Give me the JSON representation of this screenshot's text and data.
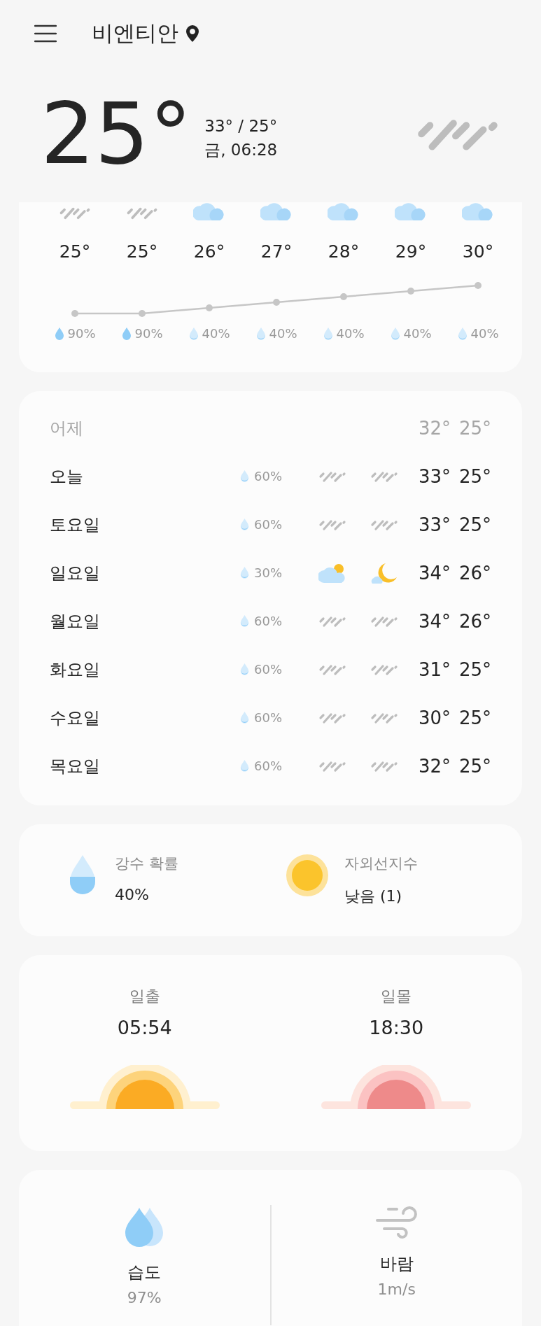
{
  "header": {
    "location": "비엔티안"
  },
  "current": {
    "temp": "25°",
    "high_low": "33° / 25°",
    "day_time": "금, 06:28",
    "icon": {
      "kind": "rain"
    }
  },
  "hourly": [
    {
      "kind": "rain",
      "temp": "25°",
      "drop": {
        "kind": "full"
      },
      "precip": "90%"
    },
    {
      "kind": "rain",
      "temp": "25°",
      "drop": {
        "kind": "full"
      },
      "precip": "90%"
    },
    {
      "kind": "cloudy",
      "temp": "26°",
      "drop": {
        "kind": "half"
      },
      "precip": "40%"
    },
    {
      "kind": "cloudy",
      "temp": "27°",
      "drop": {
        "kind": "half"
      },
      "precip": "40%"
    },
    {
      "kind": "cloudy",
      "temp": "28°",
      "drop": {
        "kind": "half"
      },
      "precip": "40%"
    },
    {
      "kind": "cloudy",
      "temp": "29°",
      "drop": {
        "kind": "half"
      },
      "precip": "40%"
    },
    {
      "kind": "cloudy",
      "temp": "30°",
      "drop": {
        "kind": "half"
      },
      "precip": "40%"
    }
  ],
  "yesterday": {
    "label": "어제",
    "high": "32°",
    "low": "25°"
  },
  "daily": [
    {
      "day": "오늘",
      "precip": "60%",
      "day_icon": {
        "kind": "rain"
      },
      "night_icon": {
        "kind": "rain"
      },
      "high": "33°",
      "low": "25°"
    },
    {
      "day": "토요일",
      "precip": "60%",
      "day_icon": {
        "kind": "rain"
      },
      "night_icon": {
        "kind": "rain"
      },
      "high": "33°",
      "low": "25°"
    },
    {
      "day": "일요일",
      "precip": "30%",
      "day_icon": {
        "kind": "partly-cloudy"
      },
      "night_icon": {
        "kind": "night-cloudy"
      },
      "high": "34°",
      "low": "26°"
    },
    {
      "day": "월요일",
      "precip": "60%",
      "day_icon": {
        "kind": "rain"
      },
      "night_icon": {
        "kind": "rain"
      },
      "high": "34°",
      "low": "26°"
    },
    {
      "day": "화요일",
      "precip": "60%",
      "day_icon": {
        "kind": "rain"
      },
      "night_icon": {
        "kind": "rain"
      },
      "high": "31°",
      "low": "25°"
    },
    {
      "day": "수요일",
      "precip": "60%",
      "day_icon": {
        "kind": "rain"
      },
      "night_icon": {
        "kind": "rain"
      },
      "high": "30°",
      "low": "25°"
    },
    {
      "day": "목요일",
      "precip": "60%",
      "day_icon": {
        "kind": "rain"
      },
      "night_icon": {
        "kind": "rain"
      },
      "high": "32°",
      "low": "25°"
    }
  ],
  "summary": [
    {
      "kind": "precipitation",
      "label": "강수 확률",
      "value": "40%"
    },
    {
      "kind": "uv",
      "label": "자외선지수",
      "value": "낮음 (1)"
    }
  ],
  "sun": [
    {
      "kind": "sunrise",
      "label": "일출",
      "time": "05:54"
    },
    {
      "kind": "sunset",
      "label": "일몰",
      "time": "18:30"
    }
  ],
  "details": [
    {
      "kind": "humidity",
      "label": "습도",
      "value": "97%"
    },
    {
      "kind": "wind",
      "label": "바람",
      "value": "1m/s"
    }
  ]
}
